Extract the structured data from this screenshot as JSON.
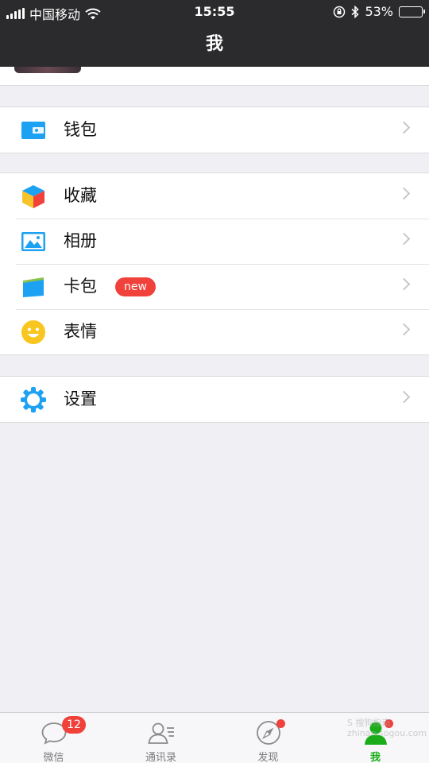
{
  "status_bar": {
    "carrier": "中国移动",
    "time": "15:55",
    "battery": "53%",
    "battery_level": 0.53,
    "icons": [
      "signal-icon",
      "wifi-icon",
      "rotation-lock-icon",
      "bluetooth-icon",
      "battery-icon"
    ]
  },
  "nav": {
    "title": "我"
  },
  "groups": {
    "wallet": {
      "label": "钱包",
      "icon": "wallet-icon"
    },
    "favorites": {
      "label": "收藏",
      "icon": "cube-icon"
    },
    "album": {
      "label": "相册",
      "icon": "picture-icon"
    },
    "cards": {
      "label": "卡包",
      "icon": "card-icon",
      "badge": "new"
    },
    "stickers": {
      "label": "表情",
      "icon": "smiley-icon"
    },
    "settings": {
      "label": "设置",
      "icon": "gear-icon"
    }
  },
  "tabbar": {
    "chats": {
      "label": "微信",
      "badge": "12",
      "icon": "chat-bubble-icon"
    },
    "contacts": {
      "label": "通讯录",
      "icon": "contacts-icon"
    },
    "discover": {
      "label": "发现",
      "icon": "compass-icon",
      "dot": true
    },
    "me": {
      "label": "我",
      "icon": "person-icon",
      "dot": true,
      "active": true
    }
  },
  "watermark": {
    "line1": "S 搜狗指南",
    "line2": "zhinan.sogou.com"
  },
  "colors": {
    "accent_green": "#1aad19",
    "badge_red": "#f0413b",
    "header_bg": "#2b2b2d",
    "icon_blue": "#1da1f2"
  }
}
